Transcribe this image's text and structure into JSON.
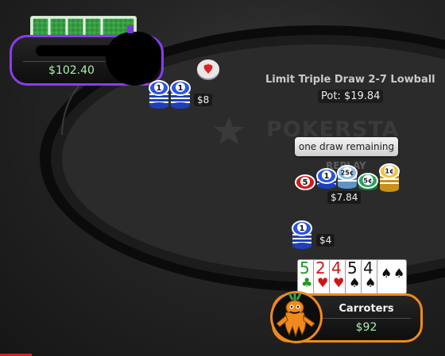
{
  "game": {
    "title": "Limit Triple Draw 2-7 Lowball",
    "pot": "Pot: $19.84",
    "watermark": "POKERSTA",
    "replay_label": "REPLAY"
  },
  "draw_status": "one draw remaining",
  "seats": {
    "top": {
      "stack": "$102.40",
      "bet": "$8",
      "bet_chips": [
        "1",
        "1"
      ]
    },
    "hero": {
      "name": "Carroters",
      "stack": "$92",
      "bet": "$4",
      "bet_chips": [
        "1"
      ]
    }
  },
  "center_pot": {
    "amount": "$7.84",
    "chips": [
      "5",
      "1",
      "25¢",
      "5¢",
      "1¢"
    ]
  },
  "hero_cards": [
    {
      "rank": "5",
      "suit": "♣",
      "color": "green"
    },
    {
      "rank": "2",
      "suit": "♥",
      "color": "red"
    },
    {
      "rank": "4",
      "suit": "♥",
      "color": "red"
    },
    {
      "rank": "5",
      "suit": "♠",
      "color": "black"
    },
    {
      "rank": "4",
      "suit": "♠",
      "color": "black"
    },
    {
      "rank": "",
      "suit": "♠",
      "color": "black"
    }
  ],
  "colors": {
    "table_rim": "#0a0a0a",
    "felt": "#2b2b2b",
    "top_seat_ring": "#8a3cf0",
    "hero_seat_ring": "#f08a1c",
    "stack_text": "#a8efa8"
  }
}
